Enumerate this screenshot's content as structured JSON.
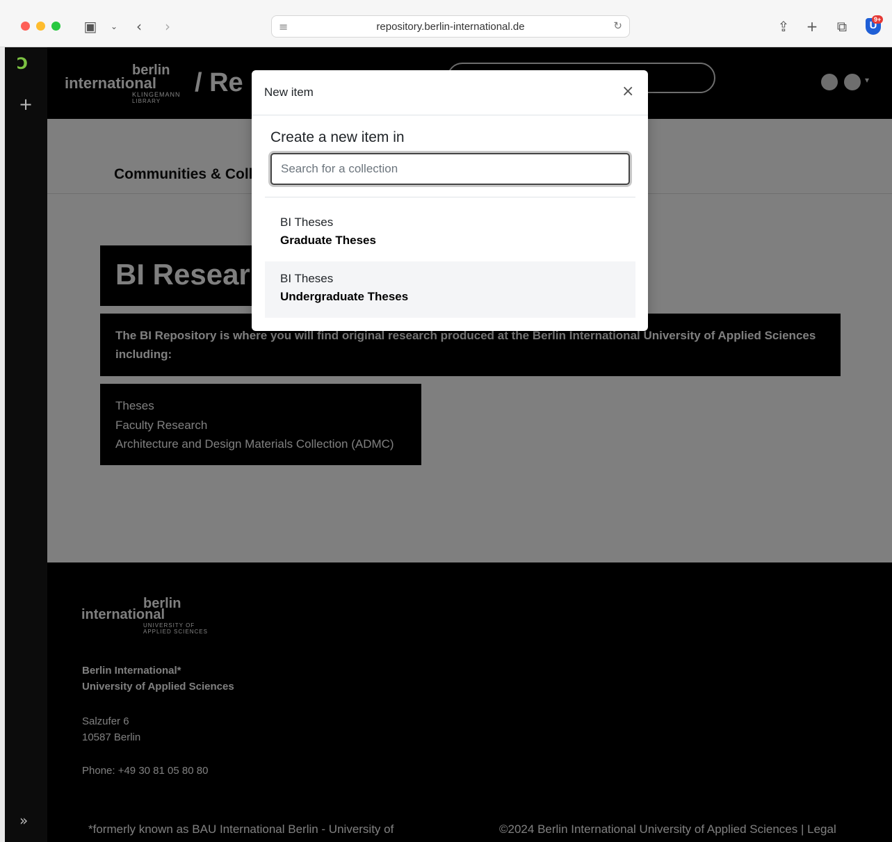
{
  "browser": {
    "url": "repository.berlin-international.de",
    "extension_badge": "9+"
  },
  "header": {
    "logo": {
      "berlin": "berlin",
      "international": "international",
      "sub1": "KLINGEMANN",
      "sub2": "LIBRARY"
    },
    "title_fragment": "/ Re"
  },
  "main": {
    "breadcrumb": "Communities & Coll",
    "hero_title": "BI Resear",
    "intro": "The BI Repository is where you will find original research produced at the Berlin International University of Applied Sciences including:",
    "list": [
      "Theses",
      "Faculty Research",
      "Architecture and Design Materials Collection (ADMC)"
    ]
  },
  "modal": {
    "title": "New item",
    "close_label": "×",
    "heading": "Create a new item in",
    "search_placeholder": "Search for a collection",
    "results": [
      {
        "parent": "BI Theses",
        "name": "Graduate Theses"
      },
      {
        "parent": "BI Theses",
        "name": "Undergraduate Theses"
      }
    ]
  },
  "footer": {
    "logo": {
      "berlin": "berlin",
      "international": "international",
      "sub1": "UNIVERSITY OF",
      "sub2": "APPLIED SCIENCES"
    },
    "org_line1": "Berlin International*",
    "org_line2": "University of Applied Sciences",
    "address_line1": "Salzufer 6",
    "address_line2": "10587 Berlin",
    "phone": "Phone: +49 30 81 05 80 80",
    "formerly": "*formerly known as BAU International Berlin - University of",
    "copyright": "©2024 Berlin International University of Applied Sciences  | Legal"
  },
  "colors": {
    "accent_green": "#7cc242",
    "extension_blue": "#1f5fd6",
    "badge_red": "#e53935"
  }
}
